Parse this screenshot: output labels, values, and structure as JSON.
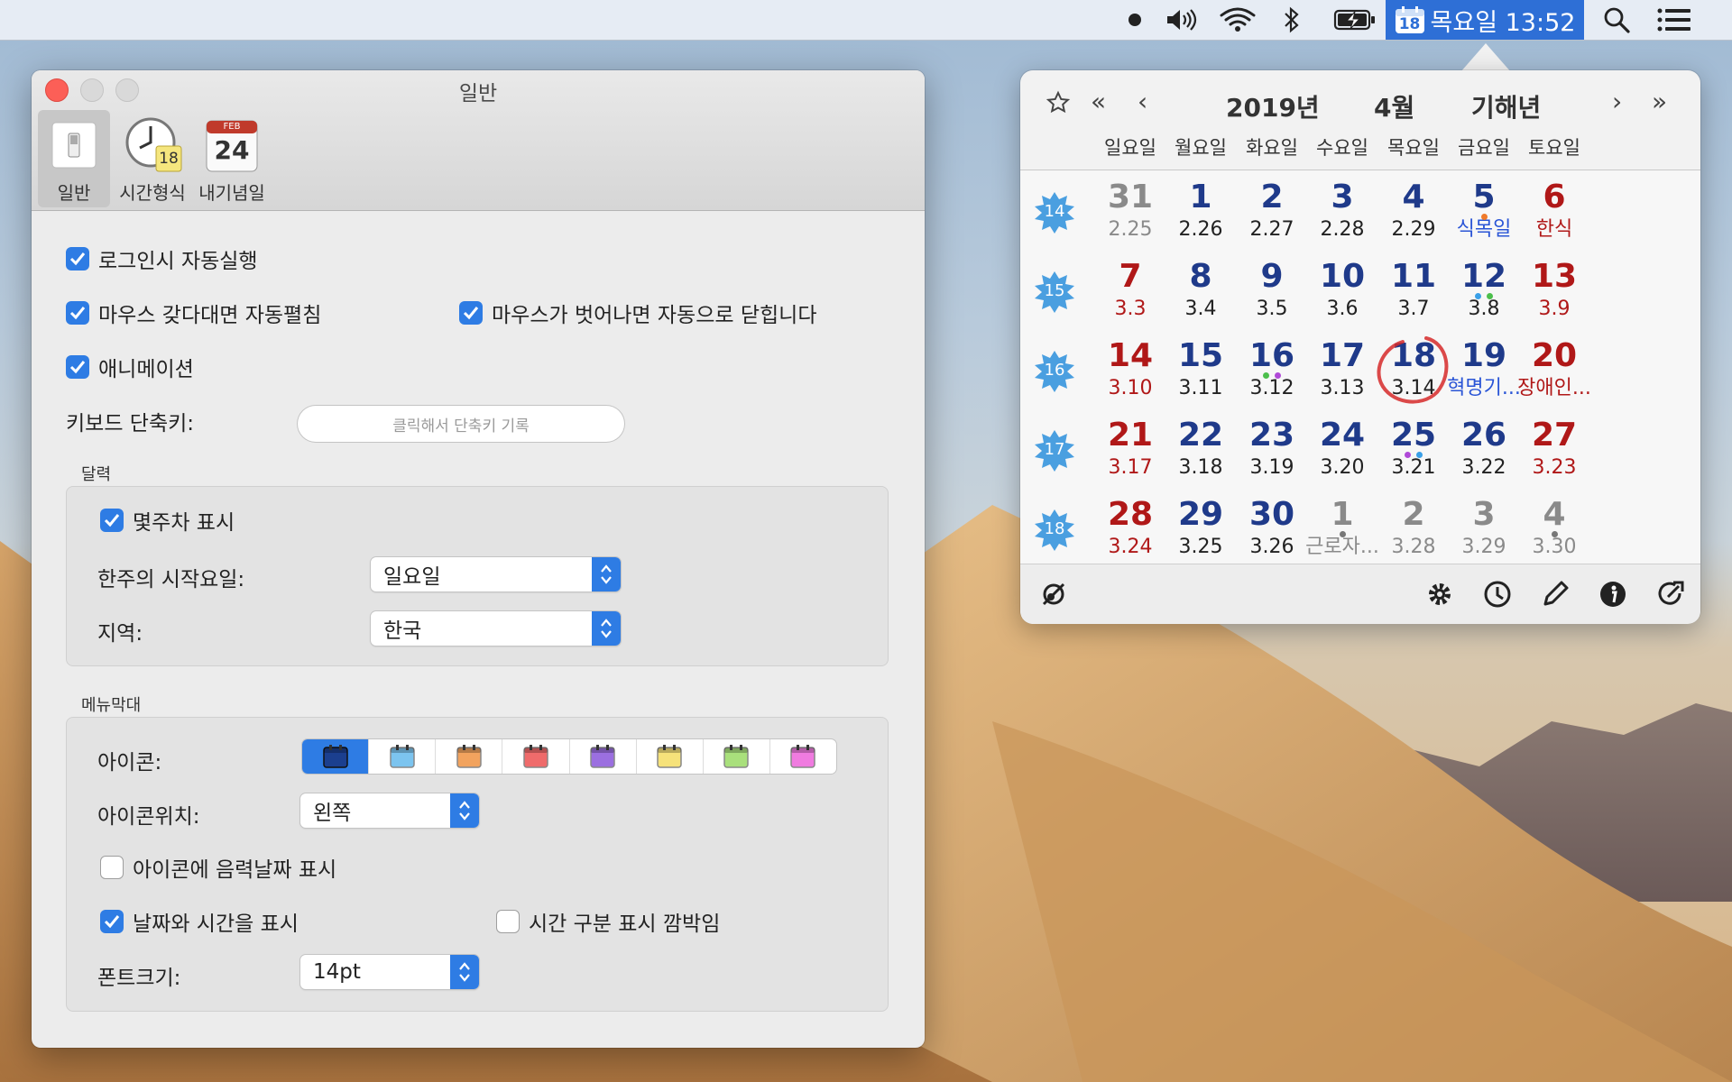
{
  "menubar": {
    "clock_text": "목요일 13:52",
    "calendar_icon_day": "18",
    "icons": [
      "record-dot-icon",
      "volume-icon",
      "wifi-icon",
      "bluetooth-icon",
      "battery-charging-icon",
      "calendar-icon",
      "spotlight-search-icon",
      "notification-center-icon"
    ]
  },
  "prefs": {
    "window_title": "일반",
    "toolbar": [
      {
        "label": "일반",
        "icon": "switch-icon"
      },
      {
        "label": "시간형식",
        "icon": "clock-icon",
        "badge": "18"
      },
      {
        "label": "내기념일",
        "icon": "calendar-date-icon",
        "month": "FEB",
        "day": "24"
      }
    ],
    "launch_at_login": {
      "label": "로그인시 자동실행",
      "checked": true
    },
    "auto_open_hover": {
      "label": "마우스 갖다대면 자동펼침",
      "checked": true
    },
    "auto_close_leave": {
      "label": "마우스가 벗어나면 자동으로 닫힙니다",
      "checked": true
    },
    "animation": {
      "label": "애니메이션",
      "checked": true
    },
    "shortcut": {
      "label": "키보드 단축키:",
      "placeholder": "클릭해서 단축키 기록"
    },
    "calendar_group": {
      "title": "달력",
      "show_week_number": {
        "label": "몇주차 표시",
        "checked": true
      },
      "week_start": {
        "label": "한주의 시작요일:",
        "value": "일요일"
      },
      "region": {
        "label": "지역:",
        "value": "한국"
      }
    },
    "menubar_group": {
      "title": "메뉴막대",
      "icon_label": "아이콘:",
      "icon_colors": [
        "#1b3f8f",
        "#7cc4ef",
        "#f2a35e",
        "#ef6b6b",
        "#9b6fe0",
        "#f6e27a",
        "#a9e07c",
        "#f07be0"
      ],
      "icon_selected_index": 0,
      "icon_position": {
        "label": "아이콘위치:",
        "value": "왼쪽"
      },
      "show_lunar_on_icon": {
        "label": "아이콘에 음력날짜 표시",
        "checked": false
      },
      "show_date_time": {
        "label": "날짜와 시간을 표시",
        "checked": true
      },
      "blink_separator": {
        "label": "시간 구분 표시 깜박임",
        "checked": false
      },
      "font_size": {
        "label": "폰트크기:",
        "value": "14pt"
      }
    }
  },
  "calendar": {
    "year_label": "2019년",
    "month_label": "4월",
    "ganji_label": "기해년",
    "nav": {
      "first": "«",
      "prev": "‹",
      "next": "›",
      "last": "»"
    },
    "weekdays": [
      "일요일",
      "월요일",
      "화요일",
      "수요일",
      "목요일",
      "금요일",
      "토요일"
    ],
    "weeks": [
      {
        "no": "14",
        "days": [
          {
            "d": "31",
            "sub": "2.25",
            "kind": "other"
          },
          {
            "d": "1",
            "sub": "2.26",
            "kind": "weekday"
          },
          {
            "d": "2",
            "sub": "2.27",
            "kind": "weekday"
          },
          {
            "d": "3",
            "sub": "2.28",
            "kind": "weekday"
          },
          {
            "d": "4",
            "sub": "2.29",
            "kind": "weekday"
          },
          {
            "d": "5",
            "sub": "식목일",
            "kind": "weekday",
            "subkind": "event",
            "dots": [
              "#f07a2a"
            ]
          },
          {
            "d": "6",
            "sub": "한식",
            "kind": "holiday",
            "subkind": "holiday"
          }
        ]
      },
      {
        "no": "15",
        "days": [
          {
            "d": "7",
            "sub": "3.3",
            "kind": "holiday",
            "subkind": "holiday"
          },
          {
            "d": "8",
            "sub": "3.4",
            "kind": "weekday"
          },
          {
            "d": "9",
            "sub": "3.5",
            "kind": "weekday"
          },
          {
            "d": "10",
            "sub": "3.6",
            "kind": "weekday"
          },
          {
            "d": "11",
            "sub": "3.7",
            "kind": "weekday"
          },
          {
            "d": "12",
            "sub": "3.8",
            "kind": "weekday",
            "dots": [
              "#3aa0e8",
              "#4cbf4c"
            ]
          },
          {
            "d": "13",
            "sub": "3.9",
            "kind": "holiday",
            "subkind": "holiday"
          }
        ]
      },
      {
        "no": "16",
        "days": [
          {
            "d": "14",
            "sub": "3.10",
            "kind": "holiday",
            "subkind": "holiday"
          },
          {
            "d": "15",
            "sub": "3.11",
            "kind": "weekday"
          },
          {
            "d": "16",
            "sub": "3.12",
            "kind": "weekday",
            "dots": [
              "#4cbf4c",
              "#b04ad8"
            ]
          },
          {
            "d": "17",
            "sub": "3.13",
            "kind": "weekday"
          },
          {
            "d": "18",
            "sub": "3.14",
            "kind": "today"
          },
          {
            "d": "19",
            "sub": "혁명기...",
            "kind": "weekday",
            "subkind": "event"
          },
          {
            "d": "20",
            "sub": "장애인...",
            "kind": "holiday",
            "subkind": "holiday"
          }
        ]
      },
      {
        "no": "17",
        "days": [
          {
            "d": "21",
            "sub": "3.17",
            "kind": "holiday",
            "subkind": "holiday"
          },
          {
            "d": "22",
            "sub": "3.18",
            "kind": "weekday"
          },
          {
            "d": "23",
            "sub": "3.19",
            "kind": "weekday"
          },
          {
            "d": "24",
            "sub": "3.20",
            "kind": "weekday"
          },
          {
            "d": "25",
            "sub": "3.21",
            "kind": "weekday",
            "dots": [
              "#b04ad8",
              "#3aa0e8"
            ]
          },
          {
            "d": "26",
            "sub": "3.22",
            "kind": "weekday"
          },
          {
            "d": "27",
            "sub": "3.23",
            "kind": "holiday",
            "subkind": "holiday"
          }
        ]
      },
      {
        "no": "18",
        "days": [
          {
            "d": "28",
            "sub": "3.24",
            "kind": "holiday",
            "subkind": "holiday"
          },
          {
            "d": "29",
            "sub": "3.25",
            "kind": "weekday"
          },
          {
            "d": "30",
            "sub": "3.26",
            "kind": "weekday"
          },
          {
            "d": "1",
            "sub": "근로자...",
            "kind": "other",
            "dots": [
              "#777777"
            ]
          },
          {
            "d": "2",
            "sub": "3.28",
            "kind": "other"
          },
          {
            "d": "3",
            "sub": "3.29",
            "kind": "other"
          },
          {
            "d": "4",
            "sub": "3.30",
            "kind": "other",
            "dots": [
              "#777777"
            ]
          }
        ]
      }
    ],
    "colors": {
      "weekday": "#1f3a8a",
      "holiday": "#b01818",
      "other": "#8a8a8a",
      "event": "#2a55d6",
      "today_ring": "#d62a2a",
      "week_splash": "#4a9fe0"
    },
    "footer_icons": [
      "link-icon",
      "settings-gear-icon",
      "clock-icon",
      "pencil-icon",
      "info-icon",
      "refresh-icon"
    ]
  }
}
